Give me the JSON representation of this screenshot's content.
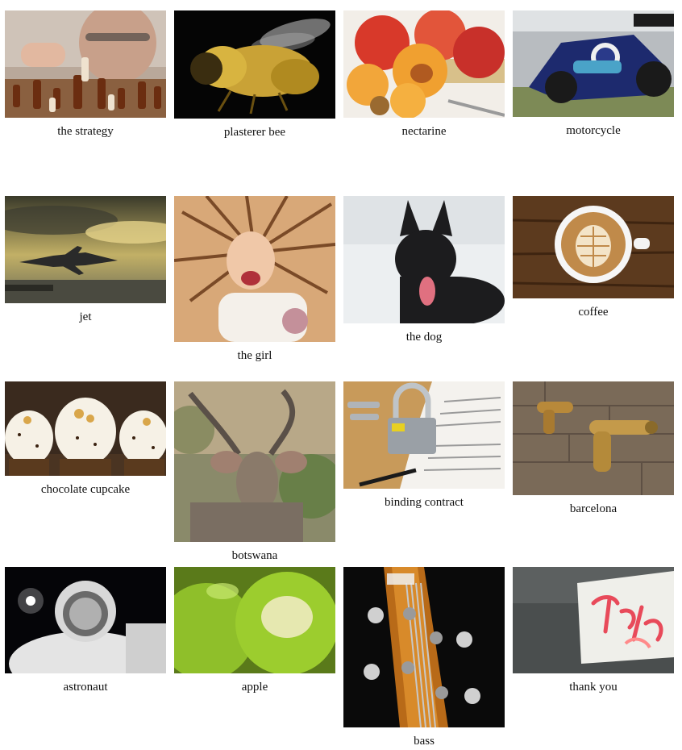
{
  "gallery": {
    "items": [
      {
        "caption": "the strategy",
        "icon": "chess-photo-icon"
      },
      {
        "caption": "plasterer bee",
        "icon": "bee-photo-icon"
      },
      {
        "caption": "nectarine",
        "icon": "nectarine-photo-icon"
      },
      {
        "caption": "motorcycle",
        "icon": "motorcycle-photo-icon"
      },
      {
        "caption": "jet",
        "icon": "jet-photo-icon"
      },
      {
        "caption": "the girl",
        "icon": "girl-photo-icon"
      },
      {
        "caption": "the dog",
        "icon": "dog-photo-icon"
      },
      {
        "caption": "coffee",
        "icon": "coffee-photo-icon"
      },
      {
        "caption": "chocolate cupcake",
        "icon": "cupcake-photo-icon"
      },
      {
        "caption": "botswana",
        "icon": "kudu-photo-icon"
      },
      {
        "caption": "binding contract",
        "icon": "padlock-contract-photo-icon"
      },
      {
        "caption": "barcelona",
        "icon": "brass-taps-photo-icon"
      },
      {
        "caption": "astronaut",
        "icon": "astronaut-photo-icon"
      },
      {
        "caption": "apple",
        "icon": "apple-photo-icon"
      },
      {
        "caption": "bass",
        "icon": "bass-guitar-photo-icon"
      },
      {
        "caption": "thank you",
        "icon": "neon-sign-photo-icon"
      }
    ]
  },
  "colors": {
    "background": "#ffffff",
    "caption_text": "#111111"
  }
}
